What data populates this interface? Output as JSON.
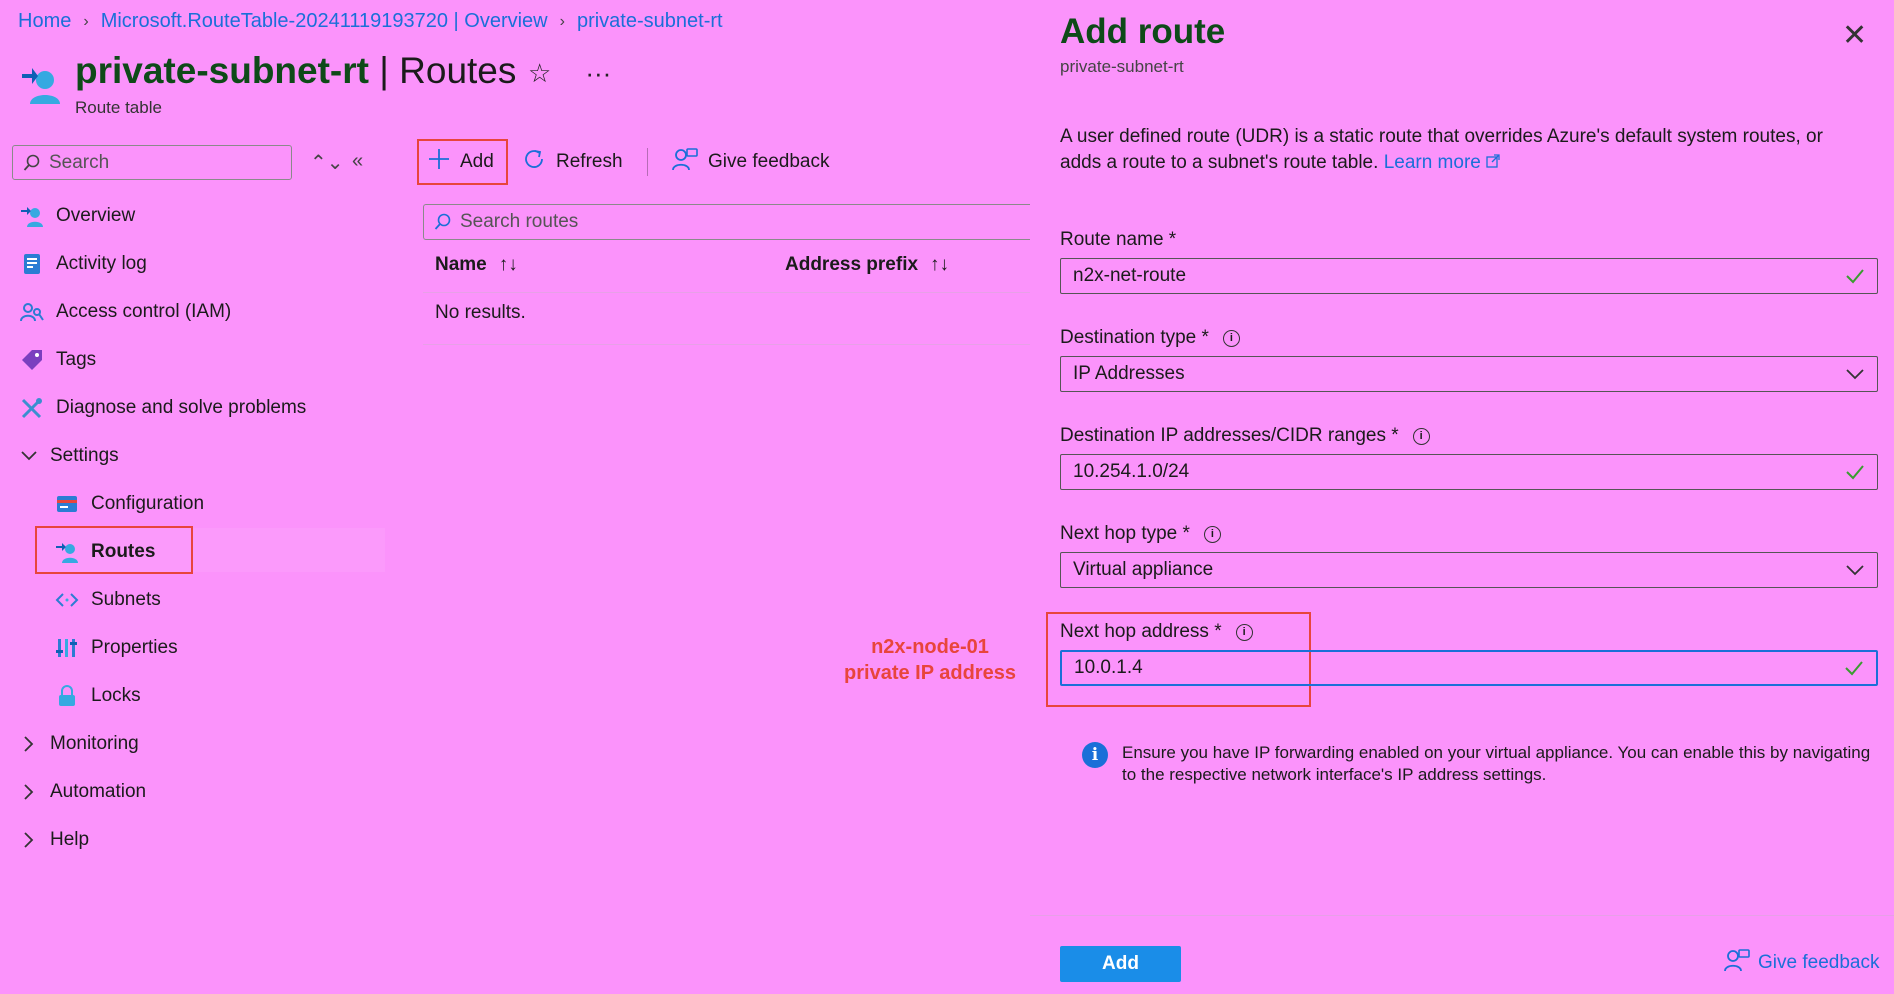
{
  "breadcrumb": [
    "Home",
    "Microsoft.RouteTable-20241119193720 | Overview",
    "private-subnet-rt"
  ],
  "page": {
    "resource_name": "private-subnet-rt",
    "section": "| Routes",
    "subtitle": "Route table",
    "favorite_glyph": "☆",
    "more_glyph": "···"
  },
  "sidebar": {
    "search_placeholder": "Search",
    "updown_glyph": "⌃⌄",
    "collapse_glyph": "«",
    "items": [
      {
        "label": "Overview",
        "icon": "route-table-icon"
      },
      {
        "label": "Activity log",
        "icon": "activity-log-icon"
      },
      {
        "label": "Access control (IAM)",
        "icon": "iam-icon"
      },
      {
        "label": "Tags",
        "icon": "tag-icon"
      },
      {
        "label": "Diagnose and solve problems",
        "icon": "wrench-icon"
      },
      {
        "label": "Settings",
        "icon": "chevron-down-icon"
      },
      {
        "label": "Configuration",
        "icon": "configuration-icon"
      },
      {
        "label": "Routes",
        "icon": "route-table-icon"
      },
      {
        "label": "Subnets",
        "icon": "subnets-icon"
      },
      {
        "label": "Properties",
        "icon": "properties-icon"
      },
      {
        "label": "Locks",
        "icon": "lock-icon"
      },
      {
        "label": "Monitoring",
        "icon": "chevron-right-icon"
      },
      {
        "label": "Automation",
        "icon": "chevron-right-icon"
      },
      {
        "label": "Help",
        "icon": "chevron-right-icon"
      }
    ]
  },
  "toolbar": {
    "add_label": "Add",
    "refresh_label": "Refresh",
    "feedback_label": "Give feedback"
  },
  "routes_list": {
    "search_placeholder": "Search routes",
    "col_name": "Name",
    "col_prefix": "Address prefix",
    "sort_glyph": "↑↓",
    "empty": "No results."
  },
  "annotation": {
    "line1": "n2x-node-01",
    "line2": "private IP address"
  },
  "panel": {
    "title": "Add route",
    "subtitle": "private-subnet-rt",
    "close_glyph": "✕",
    "description": "A user defined route (UDR) is a static route that overrides Azure's default system routes, or adds a route to a subnet's route table.",
    "learn_more": "Learn more",
    "fields": {
      "route_name_label": "Route name *",
      "route_name_value": "n2x-net-route",
      "dest_type_label": "Destination type *",
      "dest_type_value": "IP Addresses",
      "dest_ip_label": "Destination IP addresses/CIDR ranges *",
      "dest_ip_value": "10.254.1.0/24",
      "next_hop_type_label": "Next hop type *",
      "next_hop_type_value": "Virtual appliance",
      "next_hop_addr_label": "Next hop address *",
      "next_hop_addr_value": "10.0.1.4"
    },
    "note": "Ensure you have IP forwarding enabled on your virtual appliance. You can enable this by navigating to the respective network interface's IP address settings.",
    "add_button": "Add",
    "footer_feedback": "Give feedback"
  },
  "colors": {
    "background": "#fb93fb",
    "accent": "#1a6fd8",
    "highlight": "#e8453c",
    "title_green": "#0e4a18",
    "valid_check": "#3a9c2f"
  }
}
